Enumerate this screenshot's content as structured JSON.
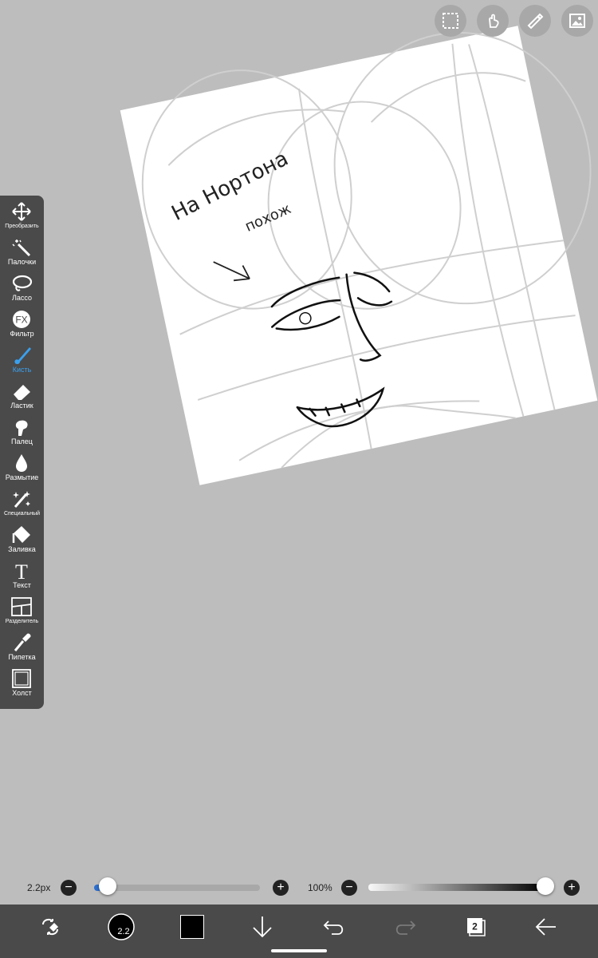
{
  "app": {
    "name": "ibisPaint"
  },
  "top_buttons": [
    {
      "name": "selection-button",
      "icon": "dashed-square-icon"
    },
    {
      "name": "hand-button",
      "icon": "hand-tap-icon"
    },
    {
      "name": "ruler-button",
      "icon": "ruler-icon"
    },
    {
      "name": "material-button",
      "icon": "image-icon"
    }
  ],
  "toolbar": {
    "items": [
      {
        "label": "Преобразить",
        "icon": "move-arrows-icon"
      },
      {
        "label": "Палочки",
        "icon": "magic-wand-icon"
      },
      {
        "label": "Лассо",
        "icon": "lasso-icon"
      },
      {
        "label": "Фильтр",
        "icon": "fx-icon"
      },
      {
        "label": "Кисть",
        "icon": "brush-icon",
        "active": true
      },
      {
        "label": "Ластик",
        "icon": "eraser-icon"
      },
      {
        "label": "Палец",
        "icon": "finger-icon"
      },
      {
        "label": "Размытие",
        "icon": "blur-drop-icon"
      },
      {
        "label": "Специальный",
        "icon": "sparkle-pen-icon"
      },
      {
        "label": "Заливка",
        "icon": "bucket-icon"
      },
      {
        "label": "Текст",
        "icon": "text-icon"
      },
      {
        "label": "Разделитель",
        "icon": "frame-divider-icon"
      },
      {
        "label": "Пипетка",
        "icon": "eyedropper-icon"
      },
      {
        "label": "Холст",
        "icon": "canvas-icon"
      }
    ],
    "active_color": "#3aa0ee"
  },
  "canvas": {
    "handwritten_note_line1": "На Нортона",
    "handwritten_note_line2": "похож"
  },
  "brush_size": {
    "label": "2.2px",
    "value": 2.2,
    "slider_fraction": 0.04
  },
  "opacity": {
    "label": "100%",
    "value": 100
  },
  "bottom_bar": {
    "brush_preview_value": "2.2",
    "color_swatch": "#000000",
    "layer_count": "2",
    "icons": [
      "transform-eraser-icon",
      "brush-preview-icon",
      "color-swatch-icon",
      "arrow-down-icon",
      "undo-icon",
      "redo-icon",
      "layers-icon",
      "back-arrow-icon"
    ]
  },
  "colors": {
    "background": "#bdbdbd",
    "toolbar": "#4a4a4a",
    "accent": "#3aa0ee"
  }
}
